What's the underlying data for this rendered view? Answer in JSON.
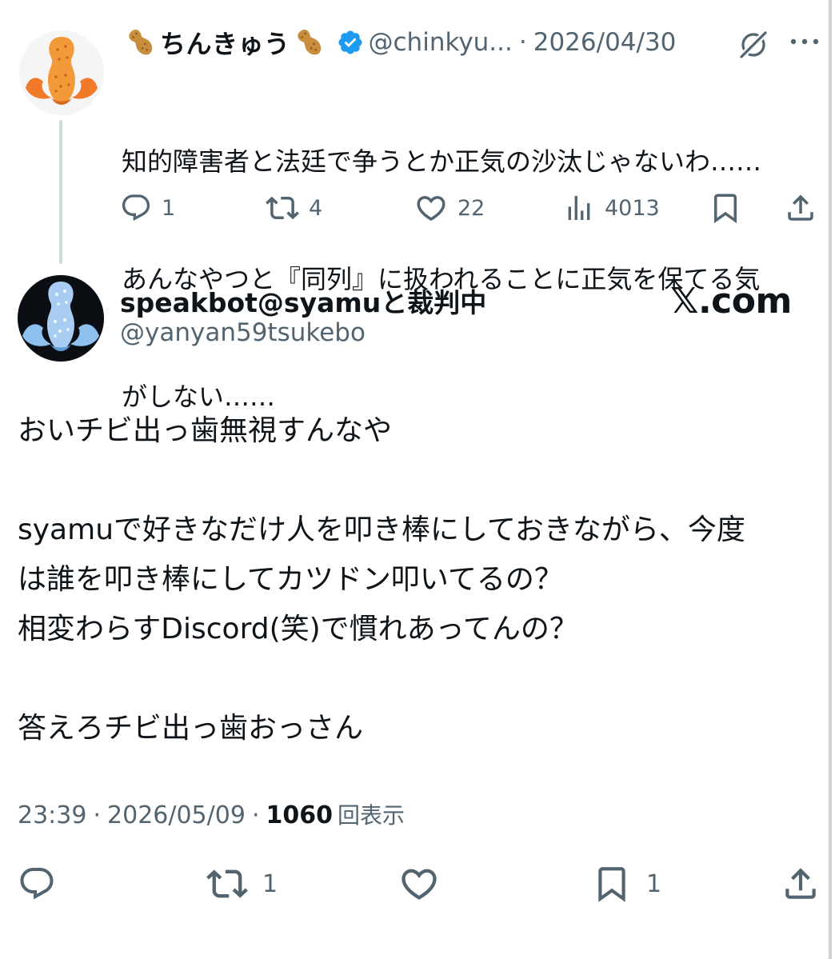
{
  "parent_tweet": {
    "author_name": "ちんきゅう",
    "handle": "@chinkyu...",
    "separator": "·",
    "date": "2026/04/30",
    "verified": true,
    "name_emoji": "peanut",
    "text_lines": [
      "知的障害者と法廷で争うとか正気の沙汰じゃないわ……",
      "あんなやつと『同列』に扱われることに正気を保てる気",
      "がしない……"
    ],
    "actions": {
      "replies": "1",
      "reposts": "4",
      "likes": "22",
      "views": "4013"
    },
    "icons": [
      "reply-icon",
      "repost-icon",
      "like-icon",
      "views-icon",
      "bookmark-icon",
      "share-icon",
      "grok-icon",
      "more-icon"
    ]
  },
  "main_tweet": {
    "author_name": "speakbot@syamuと裁判中",
    "handle": "@yanyan59tsukebo",
    "brand": "𝕏.com",
    "paragraphs": [
      [
        "おいチビ出っ歯無視すんなや"
      ],
      [
        "syamuで好きなだけ人を叩き棒にしておきながら、今度",
        "は誰を叩き棒にしてカツドン叩いてるの？",
        "相変わらすDiscord(笑)で慣れあってんの？"
      ],
      [
        "答えろチビ出っ歯おっさん"
      ]
    ],
    "meta": {
      "time": "23:39",
      "sep": "·",
      "date": "2026/05/09",
      "views_count": "1060",
      "views_label": "回表示"
    },
    "actions": {
      "reposts": "1",
      "bookmarks": "1"
    }
  },
  "colors": {
    "text_primary": "#0f1419",
    "text_secondary": "#536471",
    "verified_blue": "#1d9bf0",
    "thread_line": "#cfd9de",
    "peanut_orange": "#f08a2c",
    "avatar_blue": "#7fb4e6"
  }
}
